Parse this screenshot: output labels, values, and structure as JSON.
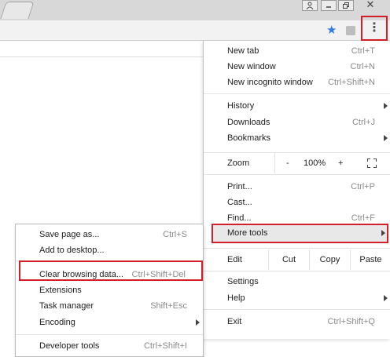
{
  "window": {
    "user_icon": "user-icon",
    "minimize_icon": "minimize-icon",
    "restore_icon": "restore-icon",
    "close_icon": "close-icon"
  },
  "toolbar": {
    "bookmark_icon": "star-icon",
    "extension_icon": "extension-icon",
    "menu_icon": "kebab-menu-icon"
  },
  "menu": {
    "new_tab": {
      "label": "New tab",
      "shortcut": "Ctrl+T"
    },
    "new_window": {
      "label": "New window",
      "shortcut": "Ctrl+N"
    },
    "new_incognito": {
      "label": "New incognito window",
      "shortcut": "Ctrl+Shift+N"
    },
    "history": {
      "label": "History"
    },
    "downloads": {
      "label": "Downloads",
      "shortcut": "Ctrl+J"
    },
    "bookmarks": {
      "label": "Bookmarks"
    },
    "zoom": {
      "label": "Zoom",
      "minus": "-",
      "value": "100%",
      "plus": "+"
    },
    "print": {
      "label": "Print...",
      "shortcut": "Ctrl+P"
    },
    "cast": {
      "label": "Cast..."
    },
    "find": {
      "label": "Find...",
      "shortcut": "Ctrl+F"
    },
    "more_tools": {
      "label": "More tools"
    },
    "edit": {
      "label": "Edit",
      "cut": "Cut",
      "copy": "Copy",
      "paste": "Paste"
    },
    "settings": {
      "label": "Settings"
    },
    "help": {
      "label": "Help"
    },
    "exit": {
      "label": "Exit",
      "shortcut": "Ctrl+Shift+Q"
    }
  },
  "submenu": {
    "save_page": {
      "label": "Save page as...",
      "shortcut": "Ctrl+S"
    },
    "add_desktop": {
      "label": "Add to desktop..."
    },
    "clear_data": {
      "label": "Clear browsing data...",
      "shortcut": "Ctrl+Shift+Del"
    },
    "extensions": {
      "label": "Extensions"
    },
    "task_manager": {
      "label": "Task manager",
      "shortcut": "Shift+Esc"
    },
    "encoding": {
      "label": "Encoding"
    },
    "dev_tools": {
      "label": "Developer tools",
      "shortcut": "Ctrl+Shift+I"
    }
  },
  "colors": {
    "highlight_border": "#d21f2a",
    "star": "#2f7de1",
    "hover_bg": "#e8e8e8"
  }
}
